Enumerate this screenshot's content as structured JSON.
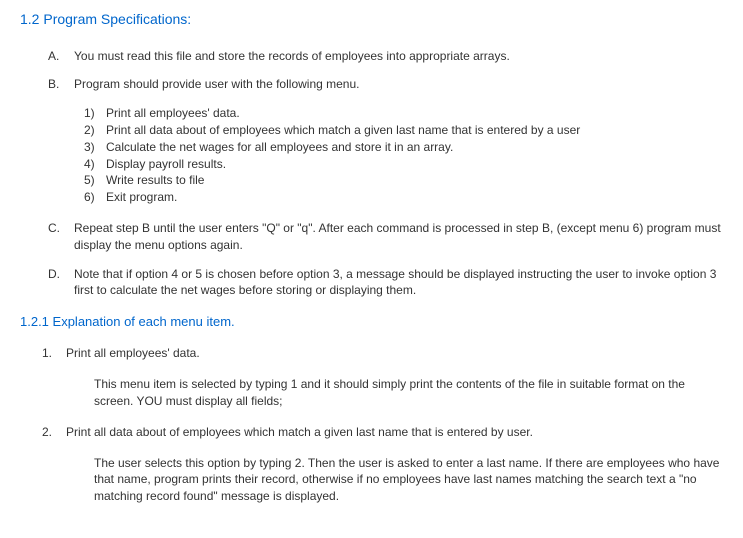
{
  "heading_1_2": "1.2 Program Specifications:",
  "spec_A": {
    "marker": "A.",
    "text": "You must read this file and store the records of employees into appropriate arrays."
  },
  "spec_B": {
    "marker": "B.",
    "text": "Program should provide user with the following menu."
  },
  "menu_items": [
    {
      "marker": "1)",
      "text": "Print all employees' data."
    },
    {
      "marker": "2)",
      "text": "Print all data about of employees which match a given last name that is entered by a user"
    },
    {
      "marker": "3)",
      "text": "Calculate the net wages for all employees and store it in an array."
    },
    {
      "marker": "4)",
      "text": "Display payroll results."
    },
    {
      "marker": "5)",
      "text": "Write results to file"
    },
    {
      "marker": "6)",
      "text": "Exit program."
    }
  ],
  "spec_C": {
    "marker": "C.",
    "text": "Repeat step B until the user enters \"Q\" or \"q\". After each command is processed in step B, (except menu 6) program must display the menu options again."
  },
  "spec_D": {
    "marker": "D.",
    "text": "Note that if option 4 or 5 is chosen before option 3, a message should be displayed instructing the user to invoke option 3 first to calculate the net wages before storing or displaying them."
  },
  "heading_1_2_1": "1.2.1 Explanation of each menu item.",
  "expl_1": {
    "marker": "1.",
    "title": "Print all employees' data.",
    "body": "This menu item is selected by typing 1 and it should simply print the contents of the file in suitable format on the screen. YOU must display all fields;"
  },
  "expl_2": {
    "marker": "2.",
    "title": "Print all data about of employees which match a given last name that is entered by user.",
    "body": "The user selects this option by typing 2. Then the user is asked to enter a last name. If there are employees who have that name, program prints their record, otherwise if no employees have last names matching the search text a \"no matching record found\" message is displayed."
  }
}
